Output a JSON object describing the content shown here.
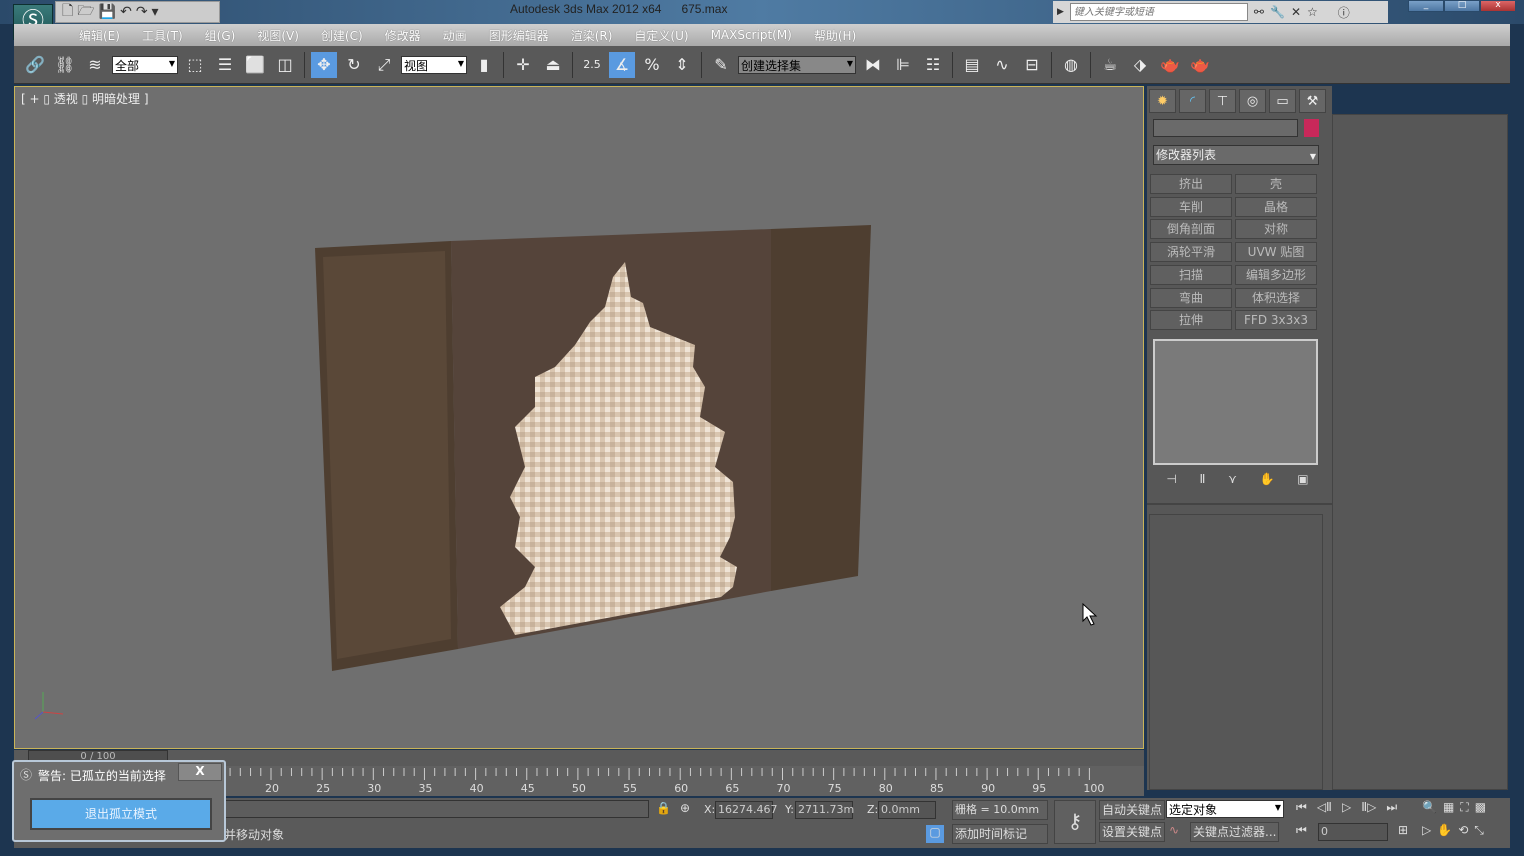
{
  "window": {
    "title": "Autodesk 3ds Max  2012 x64",
    "file": "675.max",
    "search_placeholder": "键入关键字或短语"
  },
  "menu": [
    "编辑(E)",
    "工具(T)",
    "组(G)",
    "视图(V)",
    "创建(C)",
    "修改器",
    "动画",
    "图形编辑器",
    "渲染(R)",
    "自定义(U)",
    "MAXScript(M)",
    "帮助(H)"
  ],
  "toolbar": {
    "filter": "全部",
    "ref_coord": "视图",
    "snap_value": "2.5",
    "selection_set": "创建选择集"
  },
  "viewport": {
    "label": "[ + ▯ 透视 ▯ 明暗处理 ]"
  },
  "command_panel": {
    "object_name": "",
    "object_color": "#c8285a",
    "modifier_list": "修改器列表",
    "modifiers": [
      "挤出",
      "壳",
      "车削",
      "晶格",
      "倒角剖面",
      "对称",
      "涡轮平滑",
      "UVW 贴图",
      "扫描",
      "编辑多边形",
      "弯曲",
      "体积选择",
      "拉伸",
      "FFD 3x3x3"
    ]
  },
  "timeline": {
    "position": "0 / 100",
    "ticks": [
      "20",
      "25",
      "30",
      "35",
      "40",
      "45",
      "50",
      "55",
      "60",
      "65",
      "70",
      "75",
      "80",
      "85",
      "90",
      "95",
      "100"
    ]
  },
  "dialog": {
    "title": "警告: 已孤立的当前选择",
    "close": "X",
    "button": "退出孤立模式"
  },
  "status": {
    "prompt": "并移动对象",
    "x_label": "X:",
    "x": "16274.467",
    "y_label": "Y:",
    "y": "2711.73m",
    "z_label": "Z:",
    "z": "0.0mm",
    "grid": "栅格 = 10.0mm",
    "add_time_tag": "添加时间标记",
    "auto_key": "自动关键点",
    "set_key": "设置关键点",
    "key_mode": "选定对象",
    "key_filters": "关键点过滤器...",
    "frame": "0"
  }
}
